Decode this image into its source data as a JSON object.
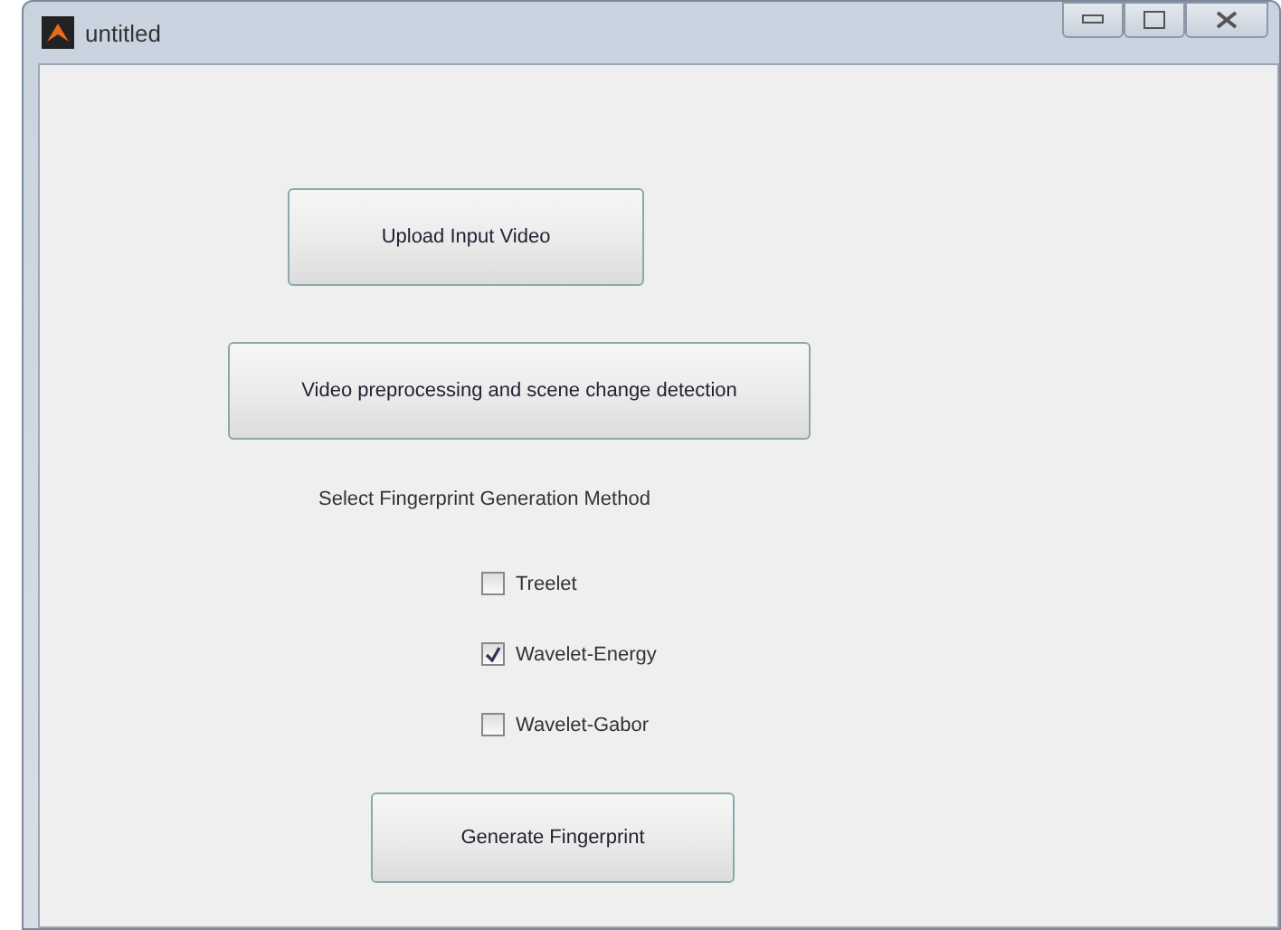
{
  "window": {
    "title": "untitled"
  },
  "buttons_top": [
    "Upload Input Video",
    "Video preprocessing and scene change detection"
  ],
  "method_label": "Select Fingerprint Generation Method",
  "methods": [
    {
      "label": "Treelet",
      "checked": false
    },
    {
      "label": "Wavelet-Energy",
      "checked": true
    },
    {
      "label": "Wavelet-Gabor",
      "checked": false
    }
  ],
  "generate_button": "Generate Fingerprint"
}
